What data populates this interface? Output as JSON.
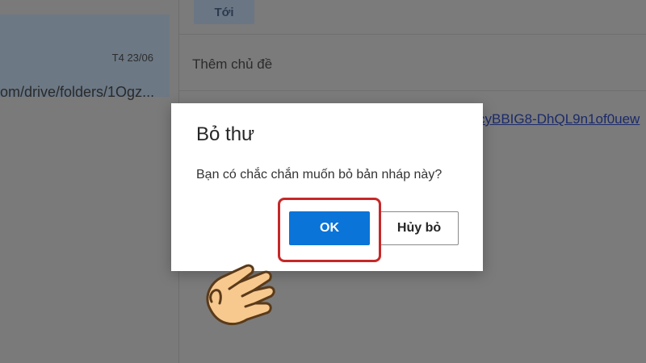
{
  "mail_list": {
    "item": {
      "date": "T4 23/06",
      "preview": "om/drive/folders/1Ogz..."
    }
  },
  "compose": {
    "to_label": "Tới",
    "subject_placeholder": "Thêm chủ đề",
    "body_link_text": "cyBBIG8-DhQL9n1of0uew"
  },
  "dialog": {
    "title": "Bỏ thư",
    "message": "Bạn có chắc chắn muốn bỏ bản nháp này?",
    "ok_label": "OK",
    "cancel_label": "Hủy bỏ"
  },
  "colors": {
    "accent": "#0a74d8",
    "highlight": "#c62828",
    "hand_fill": "#f7c98e"
  },
  "icons": {
    "pointer": "pointing-hand-icon"
  }
}
